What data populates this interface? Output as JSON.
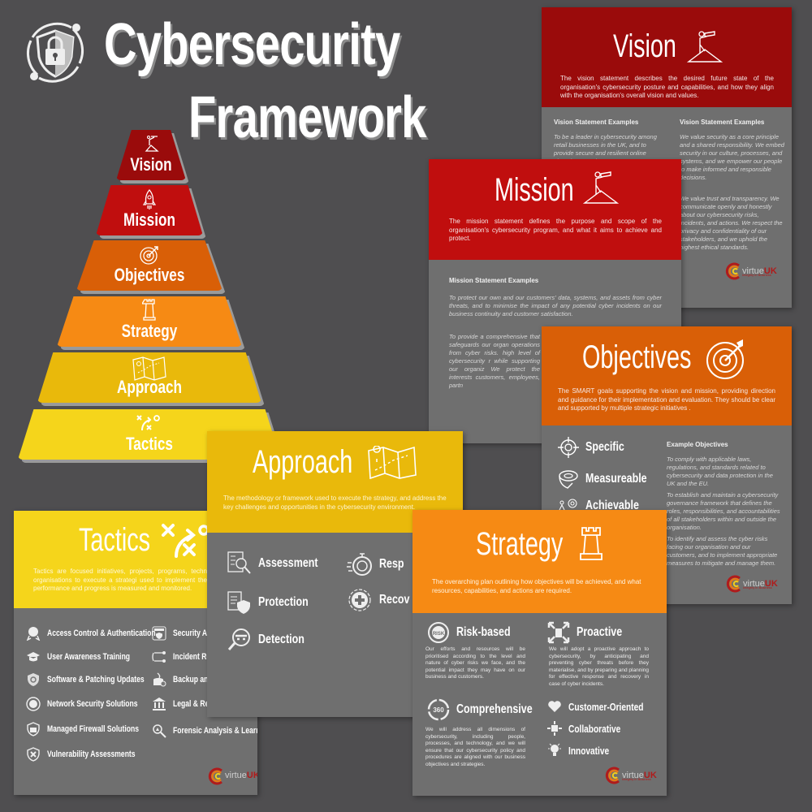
{
  "title": {
    "line1": "Cybersecurity",
    "line2": "Framework",
    "logo_icon": "shield-lock-icon"
  },
  "colors": {
    "background": "#4f4e50",
    "vision": "#9a0b0b",
    "mission": "#c00e0e",
    "objectives": "#d95f07",
    "strategy": "#f68a14",
    "approach": "#e9b90b",
    "tactics": "#f5d51b",
    "card_body": "#6f6f6f"
  },
  "pyramid": {
    "tiers": [
      {
        "label": "Vision",
        "icon": "explorer-telescope-icon"
      },
      {
        "label": "Mission",
        "icon": "rocket-icon"
      },
      {
        "label": "Objectives",
        "icon": "target-icon"
      },
      {
        "label": "Strategy",
        "icon": "chess-rook-icon"
      },
      {
        "label": "Approach",
        "icon": "map-icon"
      },
      {
        "label": "Tactics",
        "icon": "play-diagram-icon"
      }
    ]
  },
  "vision_card": {
    "title": "Vision",
    "description": "The vision statement describes the desired future state of the organisation's cybersecurity posture and capabilities, and how they align with the organisation's overall vision and values.",
    "col1_heading": "Vision Statement Examples",
    "col1_text": "To be a leader in cybersecurity among retail businesses in the UK, and to provide secure and resilient online shopping experiences to",
    "col2_heading": "Vision Statement Examples",
    "col2_text_1": "We value security as a core principle and a shared responsibility. We embed security in our culture, processes, and systems, and we empower our people to make informed and responsible decisions.",
    "col2_text_2": "We value trust and transparency. We communicate openly and honestly about our cybersecurity risks, incidents, and actions. We respect the privacy and confidentiality of our stakeholders, and we uphold the highest ethical standards."
  },
  "mission_card": {
    "title": "Mission",
    "description": "The mission statement defines the purpose and scope of the organisation's cybersecurity program, and what it aims to achieve and protect.",
    "heading": "Mission Statement Examples",
    "text_1": "To protect our own and our customers' data, systems, and assets from cyber threats, and to minimise the impact of any potential cyber incidents on our business continuity and customer satisfaction.",
    "text_2": "To provide a comprehensive that safeguards our organ operations from cyber risks. high level of cybersecurity r while supporting our organiz We protect the interests customers, employees, partn"
  },
  "objectives_card": {
    "title": "Objectives",
    "description": "The SMART goals supporting the vision and mission, providing direction and guidance for their implementation and evaluation. They should be clear and supported by multiple strategic initiatives .",
    "smart": [
      {
        "label": "Specific",
        "icon": "crosshair-icon"
      },
      {
        "label": "Measureable",
        "icon": "tape-measure-icon"
      },
      {
        "label": "Achievable",
        "icon": "person-target-icon"
      }
    ],
    "heading": "Example Objectives",
    "text_1": "To comply with applicable laws, regulations, and standards related to cybersecurity and data protection in the UK and the EU.",
    "text_2": "To establish and maintain a cybersecurity governance framework that defines the roles, responsibilities, and accountabilities of all stakeholders within and outside the organisation.",
    "text_3": "To identify and assess the cyber risks facing our organisation and our customers, and to implement appropriate measures to mitigate and manage them."
  },
  "approach_card": {
    "title": "Approach",
    "description": "The methodology or framework used to execute the  strategy, and address the key challenges and opportunities in the cybersecurity environment.",
    "items": [
      {
        "label": "Assessment",
        "icon": "checklist-magnifier-icon"
      },
      {
        "label": "Protection",
        "icon": "document-shield-icon"
      },
      {
        "label": "Detection",
        "icon": "spy-magnifier-icon"
      },
      {
        "label": "Resp",
        "icon": "stopwatch-icon"
      },
      {
        "label": "Recov",
        "icon": "medical-cross-icon"
      }
    ]
  },
  "tactics_card": {
    "title": "Tactics",
    "description": "Tactics are focused initiatives, projects, programs, techn procedures that allow organisations to execute a strategi used to implement the approach and strategy performance and progress is measured and monitored.",
    "items_left": [
      {
        "label": "Access Control & Authentication",
        "icon": "badge-icon"
      },
      {
        "label": "User Awareness Training",
        "icon": "graduation-cap-icon"
      },
      {
        "label": "Software & Patching Updates",
        "icon": "shield-gear-icon"
      },
      {
        "label": "Network Security Solutions",
        "icon": "globe-icon"
      },
      {
        "label": "Managed Firewall Solutions",
        "icon": "firewall-icon"
      },
      {
        "label": "Vulnerability Assessments",
        "icon": "shield-x-icon"
      }
    ],
    "items_right": [
      {
        "label": "Security Audi",
        "icon": "audit-icon"
      },
      {
        "label": "Incident Res",
        "icon": "connector-icon"
      },
      {
        "label": "Backup and I",
        "icon": "database-fire-icon"
      },
      {
        "label": "Legal & Regi",
        "icon": "courthouse-icon"
      },
      {
        "label": "Forensic Analysis & Learning",
        "icon": "forensic-magnifier-icon"
      }
    ]
  },
  "strategy_card": {
    "title": "Strategy",
    "description": "The overarching plan outlining how objectives will be achieved, and what resources, capabilities, and actions are required.",
    "risk_title": "Risk-based",
    "risk_text": "Our efforts and resources will be prioritised according to the level and nature of cyber risks we face, and the potential impact they may have on our business and customers.",
    "comp_title": "Comprehensive",
    "comp_text": "We will address all dimensions of cybersecurity, including people, processes, and technology, and we will ensure that our cybersecurity policy and procedures are aligned with our business objectives and strategies.",
    "proactive_title": "Proactive",
    "proactive_text": "We will adopt a proactive approach to cybersecurity, by anticipating and preventing cyber threats before they materialise, and by preparing and planning for effective response and recovery in case of cyber incidents.",
    "values": [
      {
        "label": "Customer-Oriented",
        "icon": "heart-icon"
      },
      {
        "label": "Collaborative",
        "icon": "puzzle-network-icon"
      },
      {
        "label": "Innovative",
        "icon": "lightbulb-icon"
      }
    ]
  },
  "brand": {
    "name_a": "virtue",
    "name_b": "UK",
    "tagline": "Integrity in Business"
  }
}
